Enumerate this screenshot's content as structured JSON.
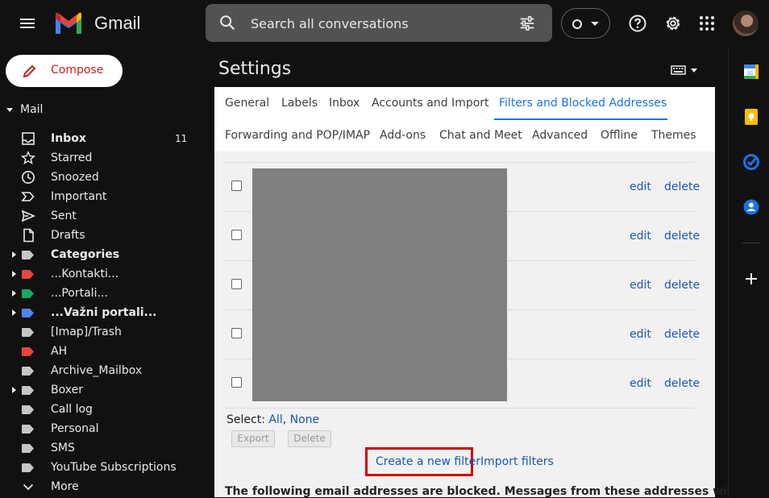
{
  "header": {
    "brand": "Gmail",
    "search_placeholder": "Search all conversations"
  },
  "sidebar": {
    "compose_label": "Compose",
    "mail_label": "Mail",
    "items": [
      {
        "label": "Inbox",
        "count": "11",
        "icon": "inbox-icon",
        "bold": true
      },
      {
        "label": "Starred",
        "icon": "star-icon"
      },
      {
        "label": "Snoozed",
        "icon": "clock-icon"
      },
      {
        "label": "Important",
        "icon": "important-icon"
      },
      {
        "label": "Sent",
        "icon": "send-icon"
      },
      {
        "label": "Drafts",
        "icon": "draft-icon"
      },
      {
        "label": "Categories",
        "icon": "label-icon",
        "bold": true,
        "expandable": true
      },
      {
        "label": "...Kontakti...",
        "icon": "label-icon",
        "color": "#e8453c",
        "expandable": true
      },
      {
        "label": "...Portali...",
        "icon": "label-icon",
        "color": "#16a765",
        "expandable": true
      },
      {
        "label": "...Važni portali...",
        "icon": "label-icon",
        "color": "#4a86e8",
        "bold": true,
        "expandable": true
      },
      {
        "label": "[Imap]/Trash",
        "icon": "label-icon"
      },
      {
        "label": "AH",
        "icon": "label-icon",
        "color": "#e8453c"
      },
      {
        "label": "Archive_Mailbox",
        "icon": "label-icon"
      },
      {
        "label": "Boxer",
        "icon": "label-icon",
        "expandable": true
      },
      {
        "label": "Call log",
        "icon": "label-icon"
      },
      {
        "label": "Personal",
        "icon": "label-icon"
      },
      {
        "label": "SMS",
        "icon": "label-icon"
      },
      {
        "label": "YouTube Subscriptions",
        "icon": "label-icon"
      },
      {
        "label": "More",
        "icon": "chevron-down-icon"
      }
    ]
  },
  "settings": {
    "title": "Settings",
    "tabs_row1": [
      "General",
      "Labels",
      "Inbox",
      "Accounts and Import",
      "Filters and Blocked Addresses"
    ],
    "tabs_row2": [
      "Forwarding and POP/IMAP",
      "Add-ons",
      "Chat and Meet",
      "Advanced",
      "Offline",
      "Themes"
    ],
    "active_tab": "Filters and Blocked Addresses",
    "filter_rows": [
      {
        "edit": "edit",
        "delete": "delete"
      },
      {
        "edit": "edit",
        "delete": "delete"
      },
      {
        "edit": "edit",
        "delete": "delete"
      },
      {
        "edit": "edit",
        "delete": "delete"
      },
      {
        "edit": "edit",
        "delete": "delete"
      }
    ],
    "select_label": "Select:",
    "select_all": "All",
    "select_sep": ",",
    "select_none": "None",
    "export_label": "Export",
    "delete_label": "Delete",
    "create_filter": "Create a new filter",
    "import_filters": "Import filters",
    "blocked_note": "The following email addresses are blocked. Messages from these addresses will appear"
  },
  "colors": {
    "accent": "#1a73e8",
    "link": "#1a57b5",
    "highlight_box": "#d50000",
    "compose_text": "#c5221f"
  }
}
